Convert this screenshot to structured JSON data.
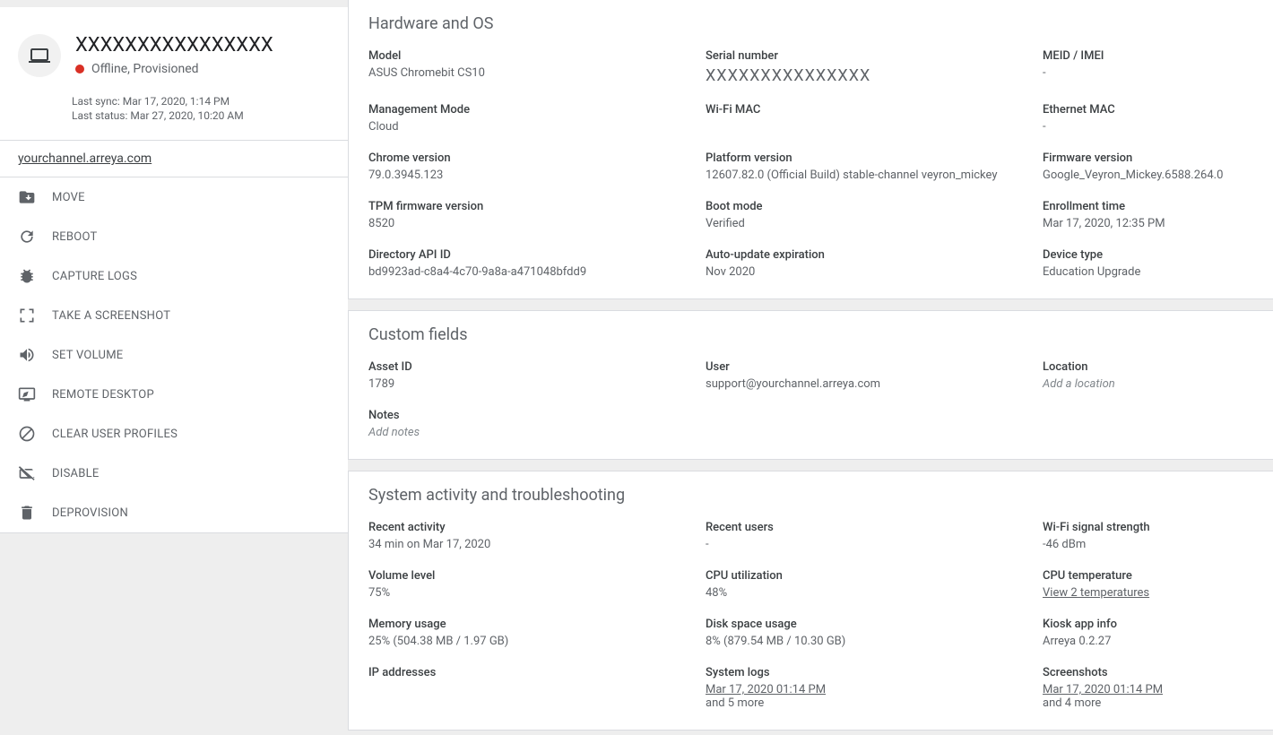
{
  "sidebar": {
    "device_name": "XXXXXXXXXXXXXXXX",
    "status_text": "Offline, Provisioned",
    "last_sync": "Last sync: Mar 17, 2020, 1:14 PM",
    "last_status": "Last status: Mar 27, 2020, 10:20 AM",
    "channel_link": "yourchannel.arreya.com",
    "actions": {
      "move": "MOVE",
      "reboot": "REBOOT",
      "capture_logs": "CAPTURE LOGS",
      "screenshot": "TAKE A SCREENSHOT",
      "set_volume": "SET VOLUME",
      "remote_desktop": "REMOTE DESKTOP",
      "clear_user_profiles": "CLEAR USER PROFILES",
      "disable": "DISABLE",
      "deprovision": "DEPROVISION"
    }
  },
  "hardware": {
    "title": "Hardware and OS",
    "model_l": "Model",
    "model": "ASUS Chromebit CS10",
    "serial_l": "Serial number",
    "serial": "XXXXXXXXXXXXXXX",
    "meid_l": "MEID / IMEI",
    "meid": "-",
    "mgmt_mode_l": "Management Mode",
    "mgmt_mode": "Cloud",
    "wifi_mac_l": "Wi-Fi MAC",
    "wifi_mac": "",
    "eth_mac_l": "Ethernet MAC",
    "eth_mac": "-",
    "chrome_ver_l": "Chrome version",
    "chrome_ver": "79.0.3945.123",
    "platform_ver_l": "Platform version",
    "platform_ver": "12607.82.0 (Official Build) stable-channel veyron_mickey",
    "firmware_ver_l": "Firmware version",
    "firmware_ver": "Google_Veyron_Mickey.6588.264.0",
    "tpm_l": "TPM firmware version",
    "tpm": "8520",
    "boot_l": "Boot mode",
    "boot": "Verified",
    "enroll_l": "Enrollment time",
    "enroll": "Mar 17, 2020, 12:35 PM",
    "dir_api_l": "Directory API ID",
    "dir_api": "bd9923ad-c8a4-4c70-9a8a-a471048bfdd9",
    "auto_upd_l": "Auto-update expiration",
    "auto_upd": "Nov 2020",
    "device_type_l": "Device type",
    "device_type": "Education Upgrade"
  },
  "custom": {
    "title": "Custom fields",
    "asset_id_l": "Asset ID",
    "asset_id": "1789",
    "user_l": "User",
    "user": "support@yourchannel.arreya.com",
    "location_l": "Location",
    "location_placeholder": "Add a location",
    "notes_l": "Notes",
    "notes_placeholder": "Add notes"
  },
  "system": {
    "title": "System activity and troubleshooting",
    "recent_activity_l": "Recent activity",
    "recent_activity": "34 min on Mar 17, 2020",
    "recent_users_l": "Recent users",
    "recent_users": "-",
    "wifi_signal_l": "Wi-Fi signal strength",
    "wifi_signal": "-46 dBm",
    "volume_l": "Volume level",
    "volume": "75%",
    "cpu_util_l": "CPU utilization",
    "cpu_util": "48%",
    "cpu_temp_l": "CPU temperature",
    "cpu_temp_link": "View 2 temperatures",
    "memory_l": "Memory usage",
    "memory": "25% (504.38 MB / 1.97 GB)",
    "disk_l": "Disk space usage",
    "disk": "8% (879.54 MB / 10.30 GB)",
    "kiosk_l": "Kiosk app info",
    "kiosk": "Arreya 0.2.27",
    "ip_l": "IP addresses",
    "syslogs_l": "System logs",
    "syslogs_link": "Mar 17, 2020 01:14 PM",
    "syslogs_more": "and 5 more",
    "screenshots_l": "Screenshots",
    "screenshots_link": "Mar 17, 2020 01:14 PM",
    "screenshots_more": "and 4 more"
  }
}
